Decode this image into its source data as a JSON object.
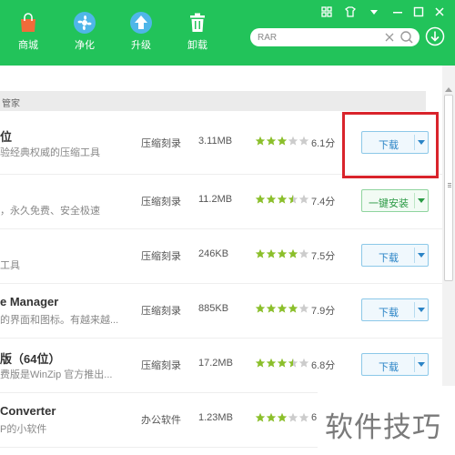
{
  "nav": {
    "shop": {
      "label": "商城",
      "icon": "shopping-bag-icon"
    },
    "clean": {
      "label": "净化",
      "icon": "fan-icon"
    },
    "upgrade": {
      "label": "升级",
      "icon": "upload-arrow-icon"
    },
    "uninstall": {
      "label": "卸载",
      "icon": "trash-icon"
    }
  },
  "window_controls": [
    "grid-icon",
    "skin-icon",
    "menu-down-icon",
    "minimize-icon",
    "maximize-icon",
    "close-icon"
  ],
  "search": {
    "value": "RAR",
    "placeholder": ""
  },
  "section": {
    "title": "管家"
  },
  "apps": [
    {
      "name": "位",
      "desc": "验经典权威的压缩工具",
      "category": "压缩刻录",
      "size": "3.11MB",
      "stars": 3,
      "rating": "6.1分",
      "button": "下载",
      "button_type": "download"
    },
    {
      "name": "",
      "desc": "，永久免费、安全极速",
      "category": "压缩刻录",
      "size": "11.2MB",
      "stars": 3.5,
      "rating": "7.4分",
      "button": "一键安装",
      "button_type": "install"
    },
    {
      "name": "",
      "desc": "工具",
      "category": "压缩刻录",
      "size": "246KB",
      "stars": 4,
      "rating": "7.5分",
      "button": "下载",
      "button_type": "download"
    },
    {
      "name": "e Manager",
      "desc": "的界面和图标。有越来越...",
      "category": "压缩刻录",
      "size": "885KB",
      "stars": 4,
      "rating": "7.9分",
      "button": "下载",
      "button_type": "download"
    },
    {
      "name": "版（64位）",
      "desc": "费版是WinZip 官方推出...",
      "category": "压缩刻录",
      "size": "17.2MB",
      "stars": 3.5,
      "rating": "6.8分",
      "button": "下载",
      "button_type": "download"
    },
    {
      "name": "Converter",
      "desc": "P的小软件",
      "category": "办公软件",
      "size": "1.23MB",
      "stars": 3,
      "rating": "6.",
      "button": "",
      "button_type": "none"
    }
  ],
  "watermark": "软件技巧",
  "colors": {
    "brand_green": "#22c35a",
    "star_gold": "#8bbf2b",
    "button_blue": "#2b84c6",
    "install_green": "#2a9a44",
    "highlight_red": "#d9232b"
  }
}
